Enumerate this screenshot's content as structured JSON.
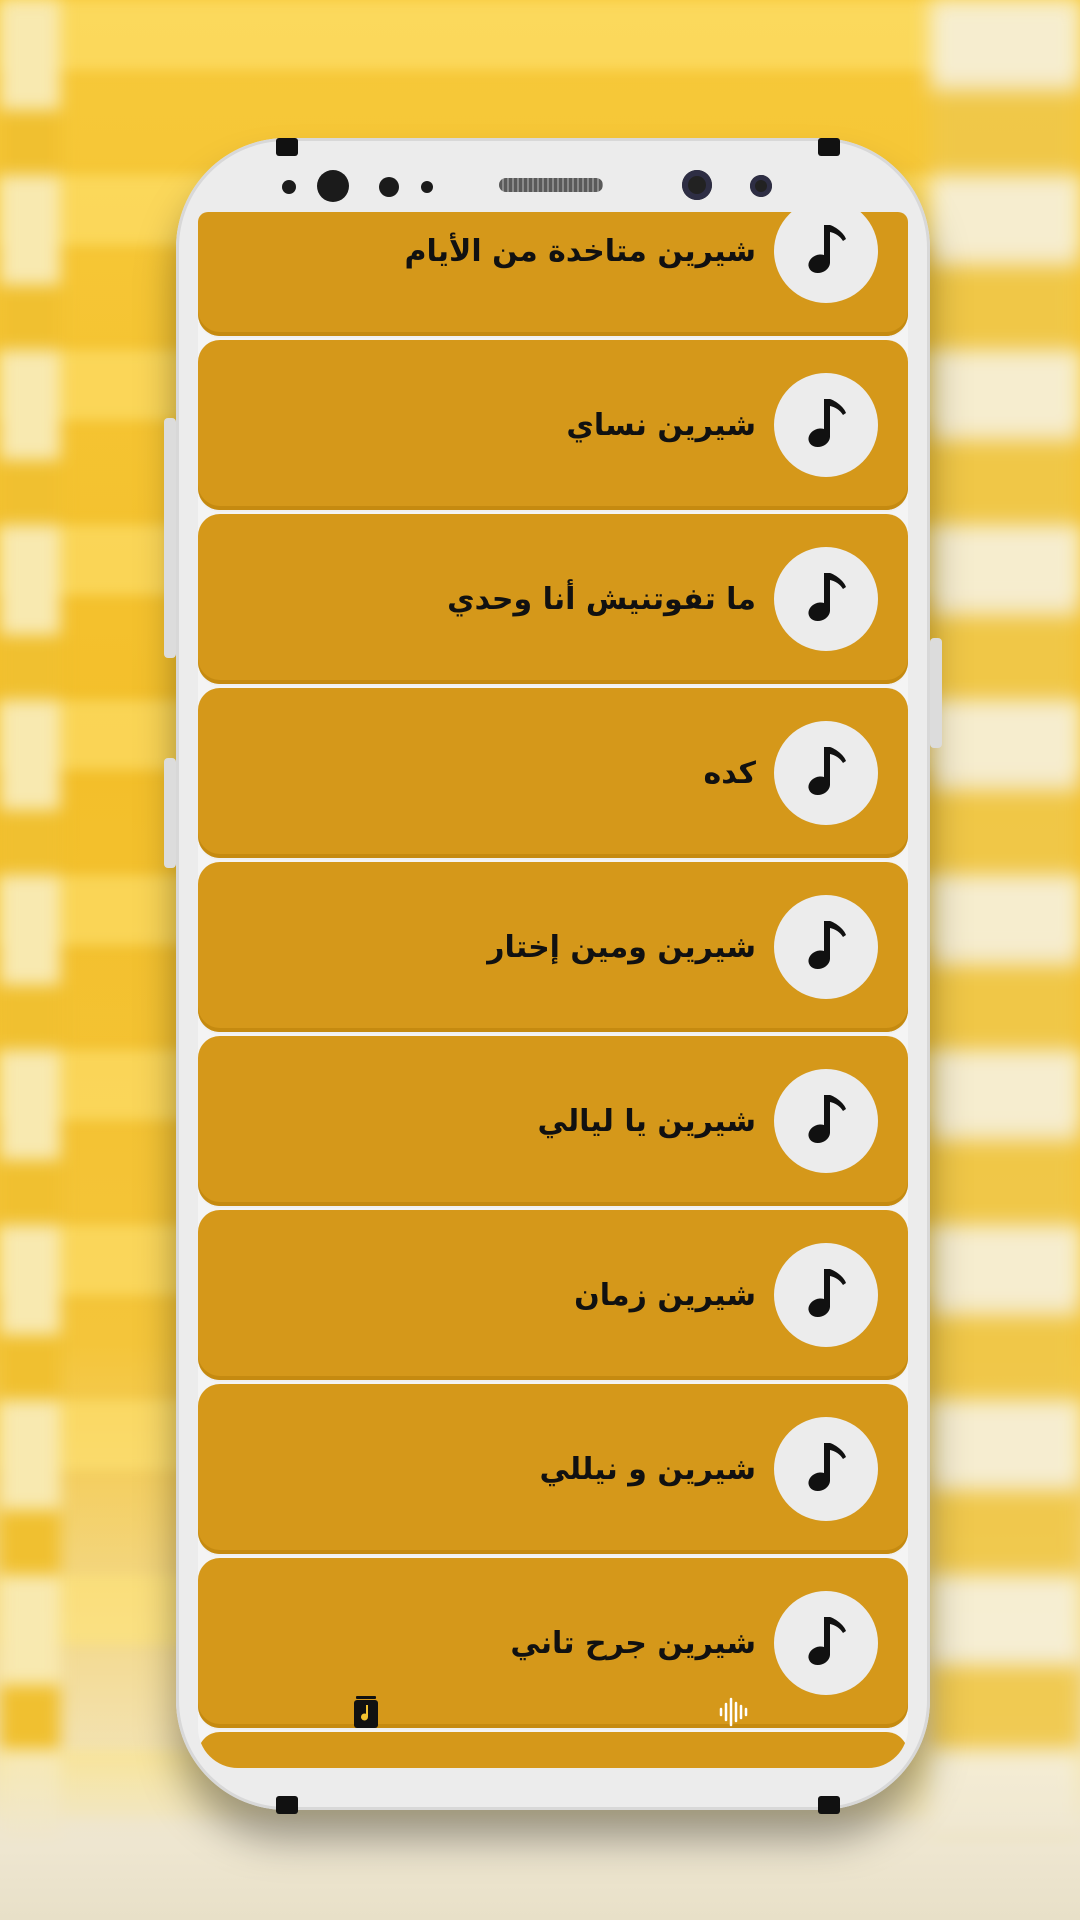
{
  "songs": [
    {
      "title": "شيرين متاخدة من الأيام",
      "icon": "music-note-icon"
    },
    {
      "title": "شيرين نساي",
      "icon": "music-note-icon"
    },
    {
      "title": "ما تفوتنيش أنا وحدي",
      "icon": "music-note-icon"
    },
    {
      "title": "كده",
      "icon": "music-note-icon"
    },
    {
      "title": "شيرين ومين إختار",
      "icon": "music-note-icon"
    },
    {
      "title": "شيرين يا ليالي",
      "icon": "music-note-icon"
    },
    {
      "title": "شيرين زمان",
      "icon": "music-note-icon"
    },
    {
      "title": "شيرين و نيللي",
      "icon": "music-note-icon"
    },
    {
      "title": "شيرين جرح تاني",
      "icon": "music-note-icon"
    }
  ],
  "bottom_nav": [
    {
      "icon": "music-file-icon"
    },
    {
      "icon": "waveform-icon"
    }
  ],
  "colors": {
    "item_background": "#d5981a",
    "icon_circle": "#ececec",
    "text": "#111111"
  }
}
